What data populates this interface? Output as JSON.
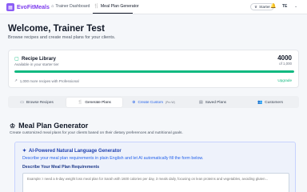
{
  "nav": {
    "brand": "EvoFitMeals",
    "links": [
      {
        "label": "Trainer Dashboard"
      },
      {
        "label": "Meal Plan Generator"
      }
    ],
    "plan_badge": "Starter",
    "avatar_initials": "TE"
  },
  "header": {
    "title": "Welcome, Trainer Test",
    "subtitle": "Browse recipes and create meal plans for your clients."
  },
  "library": {
    "title": "Recipe Library",
    "available": "Available in your starter tier",
    "count": "4000",
    "of_total": "of 1,000",
    "progress_fraction": 1.0,
    "more_text": "1,000 more recipes with Professional",
    "upgrade_label": "Upgrade"
  },
  "tabs": [
    {
      "label": "Browse Recipes",
      "icon": "book-icon"
    },
    {
      "label": "Generate Plans",
      "icon": "utensils-icon"
    },
    {
      "label": "Create Custom",
      "badge": "(Pro W)",
      "icon": "plus-icon"
    },
    {
      "label": "Saved Plans",
      "icon": "bookmark-icon"
    },
    {
      "label": "Customers",
      "icon": "users-icon"
    }
  ],
  "meal_plan": {
    "title": "Meal Plan Generator",
    "subtitle": "Create customized meal plans for your clients based on their dietary preferences and nutritional goals."
  },
  "ai": {
    "title": "AI-Powered Natural Language Generator",
    "description": "Describe your meal plan requirements in plain English and let AI automatically fill the form below.",
    "field_label": "Describe Your Meal Plan Requirements",
    "placeholder": "Example: I need a 5-day weight loss meal plan for Sarah with 1600 calories per day, 3 meals daily, focusing on lean proteins and vegetables, avoiding gluten..."
  },
  "colors": {
    "brand": "#7c3aed",
    "accent_green": "#10b981",
    "accent_blue": "#2563eb"
  }
}
